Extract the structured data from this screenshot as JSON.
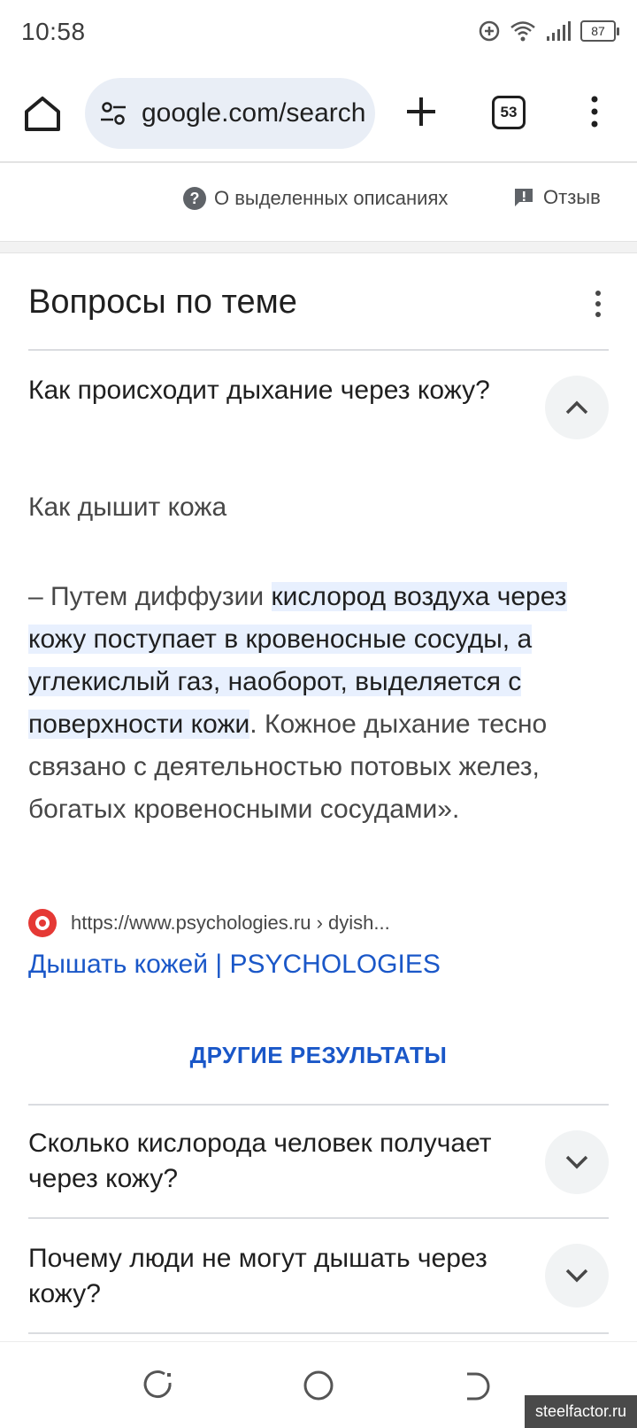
{
  "status_bar": {
    "time": "10:58",
    "battery": "87"
  },
  "browser": {
    "url": "google.com/search",
    "tab_count": "53"
  },
  "info_row": {
    "about_label": "О выделенных описаниях",
    "feedback_label": "Отзыв"
  },
  "questions": {
    "title": "Вопросы по теме",
    "expanded": {
      "question": "Как происходит дыхание через кожу?",
      "answer_heading": "Как дышит кожа",
      "answer_prefix": "– Путем диффузии ",
      "answer_highlight": "кислород воздуха через кожу поступает в кровеносные сосуды, а углекислый газ, наоборот, выделяется с поверхности кожи",
      "answer_suffix": ". Кожное дыхание тесно связано с деятельностью потовых желез, богатых кровеносными сосудами».",
      "source_url": "https://www.psychologies.ru › dyish...",
      "result_title": "Дышать кожей | PSYCHOLOGIES"
    },
    "more_results": "ДРУГИЕ РЕЗУЛЬТАТЫ",
    "collapsed": [
      {
        "question": "Сколько кислорода человек получает через кожу?"
      },
      {
        "question": "Почему люди не могут дышать через кожу?"
      }
    ]
  },
  "watermark": "steelfactor.ru",
  "icons": {
    "home": "home-icon",
    "site_info": "tune-icon",
    "new_tab": "plus-icon",
    "menu": "more-vert-icon",
    "help": "help-icon",
    "feedback": "feedback-icon",
    "expand": "chevron-down-icon",
    "collapse": "chevron-up-icon"
  }
}
